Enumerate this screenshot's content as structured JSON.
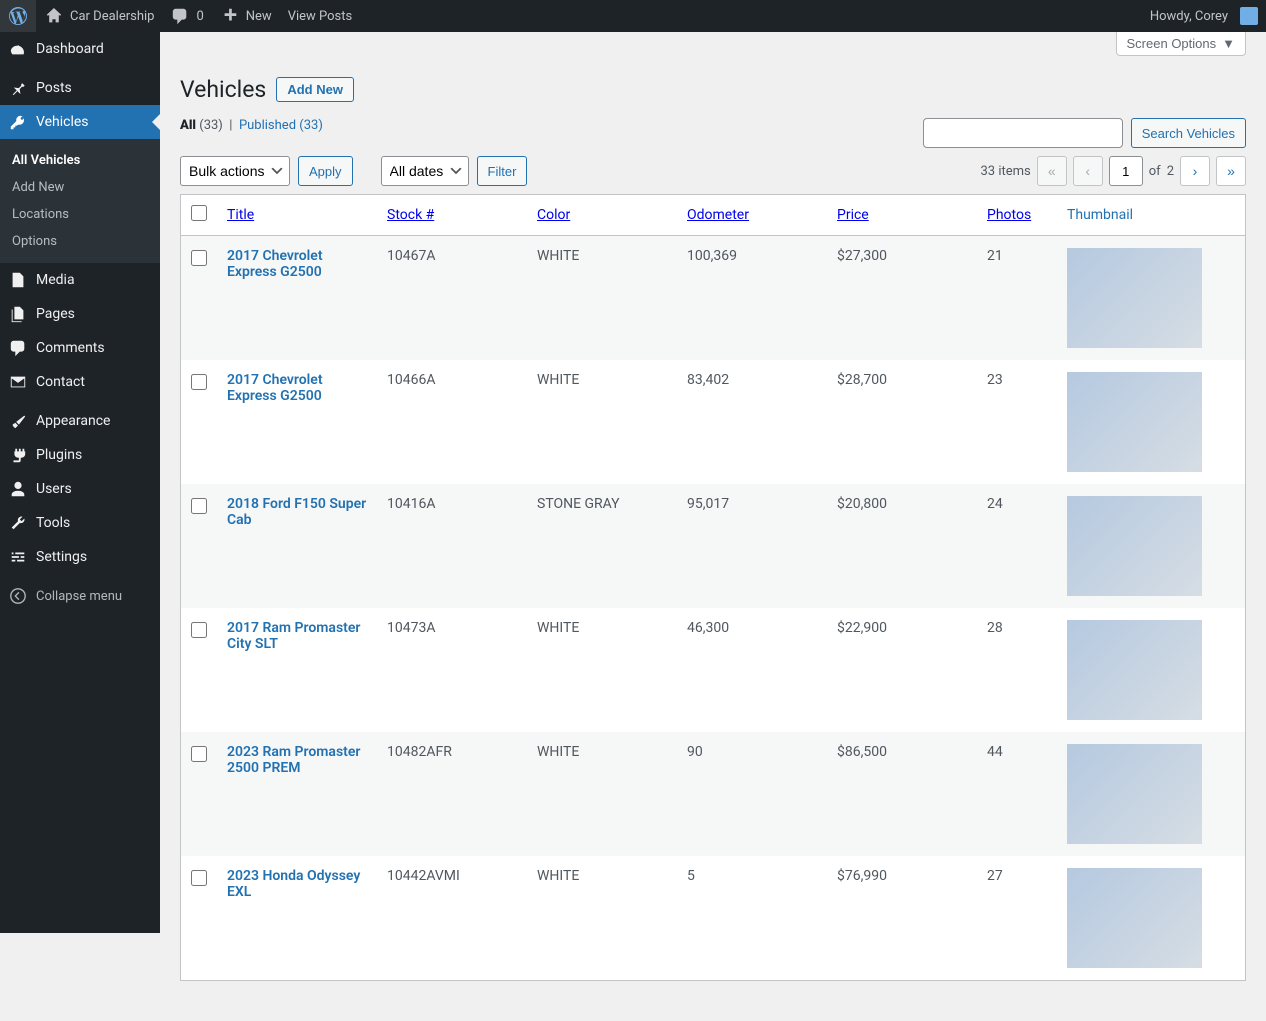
{
  "adminbar": {
    "site_name": "Car Dealership",
    "comments_count": "0",
    "new_label": "New",
    "view_posts_label": "View Posts",
    "greeting": "Howdy, Corey"
  },
  "sidebar": {
    "items": [
      {
        "id": "dashboard",
        "label": "Dashboard",
        "icon": "dashboard"
      },
      {
        "id": "posts",
        "label": "Posts",
        "icon": "pin"
      },
      {
        "id": "vehicles",
        "label": "Vehicles",
        "icon": "key",
        "current": true,
        "submenu": [
          {
            "id": "all-vehicles",
            "label": "All Vehicles",
            "current": true
          },
          {
            "id": "add-new",
            "label": "Add New"
          },
          {
            "id": "locations",
            "label": "Locations"
          },
          {
            "id": "options",
            "label": "Options"
          }
        ]
      },
      {
        "id": "media",
        "label": "Media",
        "icon": "media"
      },
      {
        "id": "pages",
        "label": "Pages",
        "icon": "pages"
      },
      {
        "id": "comments",
        "label": "Comments",
        "icon": "comment"
      },
      {
        "id": "contact",
        "label": "Contact",
        "icon": "email"
      },
      {
        "id": "appearance",
        "label": "Appearance",
        "icon": "brush"
      },
      {
        "id": "plugins",
        "label": "Plugins",
        "icon": "plug"
      },
      {
        "id": "users",
        "label": "Users",
        "icon": "user"
      },
      {
        "id": "tools",
        "label": "Tools",
        "icon": "wrench"
      },
      {
        "id": "settings",
        "label": "Settings",
        "icon": "sliders"
      }
    ],
    "collapse_label": "Collapse menu"
  },
  "screen_options_label": "Screen Options",
  "page_title": "Vehicles",
  "add_new_label": "Add New",
  "filters": {
    "all_label": "All",
    "all_count": "(33)",
    "separator": "|",
    "published_label": "Published",
    "published_count": "(33)"
  },
  "search": {
    "button_label": "Search Vehicles"
  },
  "bulk": {
    "select_label": "Bulk actions",
    "apply_label": "Apply"
  },
  "date_filter": {
    "select_label": "All dates",
    "filter_label": "Filter"
  },
  "pagination": {
    "items_text": "33 items",
    "current_page": "1",
    "of_label": "of",
    "total_pages": "2"
  },
  "table": {
    "headers": {
      "title": "Title",
      "stock": "Stock #",
      "color": "Color",
      "odometer": "Odometer",
      "price": "Price",
      "photos": "Photos",
      "thumbnail": "Thumbnail"
    },
    "rows": [
      {
        "title": "2017 Chevrolet Express G2500",
        "stock": "10467A",
        "color": "WHITE",
        "odometer": "100,369",
        "price": "$27,300",
        "photos": "21"
      },
      {
        "title": "2017 Chevrolet Express G2500",
        "stock": "10466A",
        "color": "WHITE",
        "odometer": "83,402",
        "price": "$28,700",
        "photos": "23"
      },
      {
        "title": "2018 Ford F150 Super Cab",
        "stock": "10416A",
        "color": "STONE GRAY",
        "odometer": "95,017",
        "price": "$20,800",
        "photos": "24"
      },
      {
        "title": "2017 Ram Promaster City SLT",
        "stock": "10473A",
        "color": "WHITE",
        "odometer": "46,300",
        "price": "$22,900",
        "photos": "28"
      },
      {
        "title": "2023 Ram Promaster 2500 PREM",
        "stock": "10482AFR",
        "color": "WHITE",
        "odometer": "90",
        "price": "$86,500",
        "photos": "44"
      },
      {
        "title": "2023 Honda Odyssey EXL",
        "stock": "10442AVMI",
        "color": "WHITE",
        "odometer": "5",
        "price": "$76,990",
        "photos": "27"
      }
    ]
  }
}
